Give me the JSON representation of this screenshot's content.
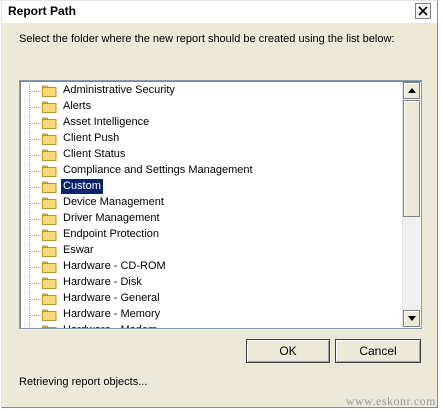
{
  "window": {
    "title": "Report Path",
    "close_glyph": "✕"
  },
  "instruction": "Select the folder where the new report should be created using the list below:",
  "tree": {
    "selected_index": 6,
    "items": [
      "Administrative Security",
      "Alerts",
      "Asset Intelligence",
      "Client Push",
      "Client Status",
      "Compliance and Settings Management",
      "Custom",
      "Device Management",
      "Driver Management",
      "Endpoint Protection",
      "Eswar",
      "Hardware - CD-ROM",
      "Hardware - Disk",
      "Hardware - General",
      "Hardware - Memory",
      "Hardware - Modem"
    ]
  },
  "buttons": {
    "ok": "OK",
    "cancel": "Cancel"
  },
  "status": "Retrieving report objects...",
  "watermark": "www.eskonr.com",
  "colors": {
    "dialog_bg": "#ece9d8",
    "selection_bg": "#0a246a",
    "folder_fill": "#f8d775",
    "folder_stroke": "#b8922f"
  },
  "icons": {
    "tree_item": "folder-icon",
    "scroll_up": "up-arrow-icon",
    "scroll_down": "down-arrow-icon"
  }
}
